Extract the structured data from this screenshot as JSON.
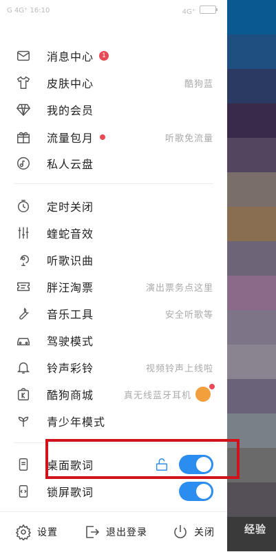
{
  "status": {
    "left": "G 4G⁺ 16:10",
    "right": "4G⁺"
  },
  "menu_group1": [
    {
      "label": "消息中心",
      "badge": "1",
      "right": ""
    },
    {
      "label": "皮肤中心",
      "right": "酷狗蓝"
    },
    {
      "label": "我的会员",
      "right": ""
    },
    {
      "label": "流量包月",
      "right": "听歌免流量"
    },
    {
      "label": "私人云盘",
      "right": ""
    }
  ],
  "menu_group2": [
    {
      "label": "定时关闭",
      "right": ""
    },
    {
      "label": "蝰蛇音效",
      "right": ""
    },
    {
      "label": "听歌识曲",
      "right": ""
    },
    {
      "label": "胖汪淘票",
      "right": "演出票务点这里"
    },
    {
      "label": "音乐工具",
      "right": "安全听歌等"
    },
    {
      "label": "驾驶模式",
      "right": ""
    },
    {
      "label": "铃声彩铃",
      "right": "视频铃声上线啦"
    },
    {
      "label": "酷狗商城",
      "right": "真无线蓝牙耳机"
    },
    {
      "label": "青少年模式",
      "right": ""
    }
  ],
  "toggles": [
    {
      "label": "桌面歌词",
      "on": true
    },
    {
      "label": "锁屏歌词",
      "on": true
    }
  ],
  "bottom": {
    "settings": "设置",
    "logout": "退出登录",
    "close": "关闭"
  },
  "watermark": "经验",
  "colors": {
    "accent": "#2c8df0",
    "badge": "#e84a56",
    "highlight": "#d0121a",
    "background_strip": [
      "#0a5a8f",
      "#1e4f80",
      "#2a3a62",
      "#3a2a4a",
      "#524560",
      "#7a6e6a",
      "#8a6e52",
      "#6e6478",
      "#8a6a88",
      "#7e7488",
      "#8a8490",
      "#6a6278",
      "#7a8088",
      "#6a6a6a",
      "#555058",
      "#3a3a3a"
    ]
  }
}
